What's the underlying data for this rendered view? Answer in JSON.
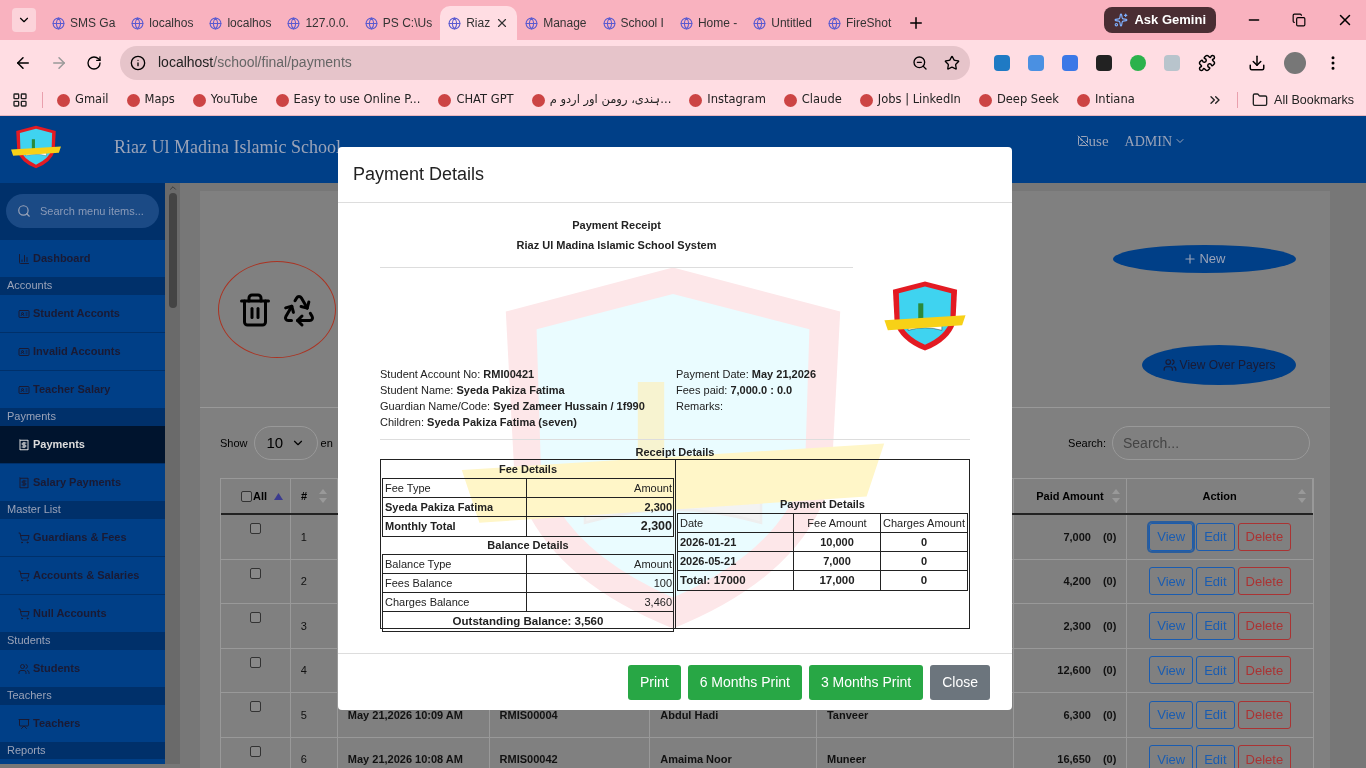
{
  "browser": {
    "tabs": [
      {
        "title": "SMS Ga",
        "selected": false
      },
      {
        "title": "localhos",
        "selected": false
      },
      {
        "title": "localhos",
        "selected": false
      },
      {
        "title": "127.0.0.",
        "selected": false
      },
      {
        "title": "PS C:\\Us",
        "selected": false
      },
      {
        "title": "Riaz",
        "selected": true
      },
      {
        "title": "Manage",
        "selected": false
      },
      {
        "title": "School I",
        "selected": false
      },
      {
        "title": "Home -",
        "selected": false
      },
      {
        "title": "Untitled",
        "selected": false
      },
      {
        "title": "FireShot",
        "selected": false
      }
    ],
    "gemini": "Ask Gemini",
    "url": {
      "host": "localhost",
      "path": "/school/final/payments"
    },
    "bookmarks": [
      "Gmail",
      "Maps",
      "YouTube",
      "Easy to use Online P...",
      "CHAT GPT",
      "ہندی، رومن اور اردو م...",
      "Instagram",
      "Claude",
      "Jobs | LinkedIn",
      "Deep Seek",
      "Intiana"
    ],
    "all_bookmarks": "All Bookmarks"
  },
  "app": {
    "title": "Riaz Ul Madina Islamic School",
    "user_image_alt": "use",
    "admin": "ADMIN"
  },
  "sidebar": {
    "search_placeholder": "Search menu items...",
    "items": [
      {
        "kind": "item",
        "label": "Dashboard",
        "selected": false
      },
      {
        "kind": "section",
        "label": "Accounts"
      },
      {
        "kind": "item",
        "label": "Student Acconts",
        "selected": false
      },
      {
        "kind": "item",
        "label": "Invalid Accounts",
        "selected": false
      },
      {
        "kind": "item",
        "label": "Teacher Salary",
        "selected": false
      },
      {
        "kind": "section",
        "label": "Payments"
      },
      {
        "kind": "item",
        "label": "Payments",
        "selected": true
      },
      {
        "kind": "item",
        "label": "Salary Payments",
        "selected": false
      },
      {
        "kind": "section",
        "label": "Master List"
      },
      {
        "kind": "item",
        "label": "Guardians & Fees",
        "selected": false
      },
      {
        "kind": "item",
        "label": "Accounts & Salaries",
        "selected": false
      },
      {
        "kind": "item",
        "label": "Null Accounts",
        "selected": false
      },
      {
        "kind": "section",
        "label": "Students"
      },
      {
        "kind": "item",
        "label": "Students",
        "selected": false
      },
      {
        "kind": "section",
        "label": "Teachers"
      },
      {
        "kind": "item",
        "label": "Teachers",
        "selected": false
      },
      {
        "kind": "section",
        "label": "Reports"
      }
    ]
  },
  "page": {
    "new_button": "New",
    "over_payers_button": "View Over Payers",
    "show_label": "Show",
    "page_size": "10",
    "entries_label": "en",
    "search_label": "Search:",
    "search_placeholder": "Search...",
    "table": {
      "all_checked": false,
      "columns": [
        {
          "label": "All",
          "sorted": true
        },
        {
          "label": "#",
          "sorted": false
        },
        {
          "label": "Paid Amount",
          "sorted": false
        },
        {
          "label": "Action",
          "sorted": false
        }
      ],
      "rows": [
        {
          "checked": false,
          "num": "1",
          "paid": "7,000",
          "note": "(0)",
          "view_focused": true,
          "actions": [
            "View",
            "Edit",
            "Delete"
          ]
        },
        {
          "checked": false,
          "num": "2",
          "paid": "4,200",
          "note": "(0)",
          "view_focused": false,
          "actions": [
            "View",
            "Edit",
            "Delete"
          ]
        },
        {
          "checked": false,
          "num": "3",
          "paid": "2,300",
          "note": "(0)",
          "view_focused": false,
          "actions": [
            "View",
            "Edit",
            "Delete"
          ]
        },
        {
          "checked": false,
          "num": "4",
          "paid": "12,600",
          "note": "(0)",
          "view_focused": false,
          "actions": [
            "View",
            "Edit",
            "Delete"
          ]
        },
        {
          "checked": false,
          "num": "5",
          "date": "May 21,2026 10:09 AM",
          "account": "RMIS00004",
          "name": "Abdul Hadi",
          "guardian": "Tanveer",
          "paid": "6,300",
          "note": "(0)",
          "view_focused": false,
          "actions": [
            "View",
            "Edit",
            "Delete"
          ]
        },
        {
          "checked": false,
          "num": "6",
          "date": "May 21,2026 10:08 AM",
          "account": "RMIS00042",
          "name": "Amaima Noor",
          "guardian": "Muneer",
          "paid": "16,650",
          "note": "(0)",
          "view_focused": false,
          "actions": [
            "View",
            "Edit",
            "Delete"
          ]
        }
      ]
    }
  },
  "modal": {
    "title": "Payment Details",
    "receipt": {
      "title": "Payment Receipt",
      "school": "Riaz Ul Madina Islamic School System",
      "left_info": [
        {
          "label": "Student Account No:",
          "value": "RMI00421"
        },
        {
          "label": "Student Name:",
          "value": "Syeda Pakiza Fatima"
        },
        {
          "label": "Guardian Name/Code:",
          "value": "Syed Zameer Hussain / 1f990"
        },
        {
          "label": "Children:",
          "value": "Syeda Pakiza Fatima (seven)"
        }
      ],
      "right_info": [
        {
          "label": "Payment Date:",
          "value": "May 21,2026"
        },
        {
          "label": "Fees paid:",
          "value": "7,000.0 : 0.0"
        },
        {
          "label": "Remarks:"
        }
      ],
      "details_caption": "Receipt Details",
      "fee_details": {
        "caption": "Fee Details",
        "header": [
          "Fee Type",
          "Amount"
        ],
        "rows": [
          {
            "label": "Syeda Pakiza Fatima",
            "amount": "2,300",
            "kind": "bold"
          },
          {
            "label": "Monthly Total",
            "amount": "2,300",
            "kind": "total"
          }
        ]
      },
      "balance_details": {
        "caption": "Balance Details",
        "header": [
          "Balance Type",
          "Amount"
        ],
        "rows": [
          {
            "label": "Fees Balance",
            "amount": "100"
          },
          {
            "label": "Charges Balance",
            "amount": "3,460"
          }
        ],
        "outstanding": "Outstanding Balance: 3,560"
      },
      "payment_details": {
        "caption": "Payment Details",
        "header": [
          "Date",
          "Fee Amount",
          "Charges Amount"
        ],
        "rows": [
          [
            "2026-01-21",
            "10,000",
            "0"
          ],
          [
            "2026-05-21",
            "7,000",
            "0"
          ]
        ],
        "total": [
          "Total: 17000",
          "17,000",
          "0"
        ]
      }
    },
    "buttons": [
      {
        "label": "Print",
        "kind": "success"
      },
      {
        "label": "6 Months Print",
        "kind": "success"
      },
      {
        "label": "3 Months Print",
        "kind": "success"
      },
      {
        "label": "Close",
        "kind": "secondary"
      }
    ]
  }
}
